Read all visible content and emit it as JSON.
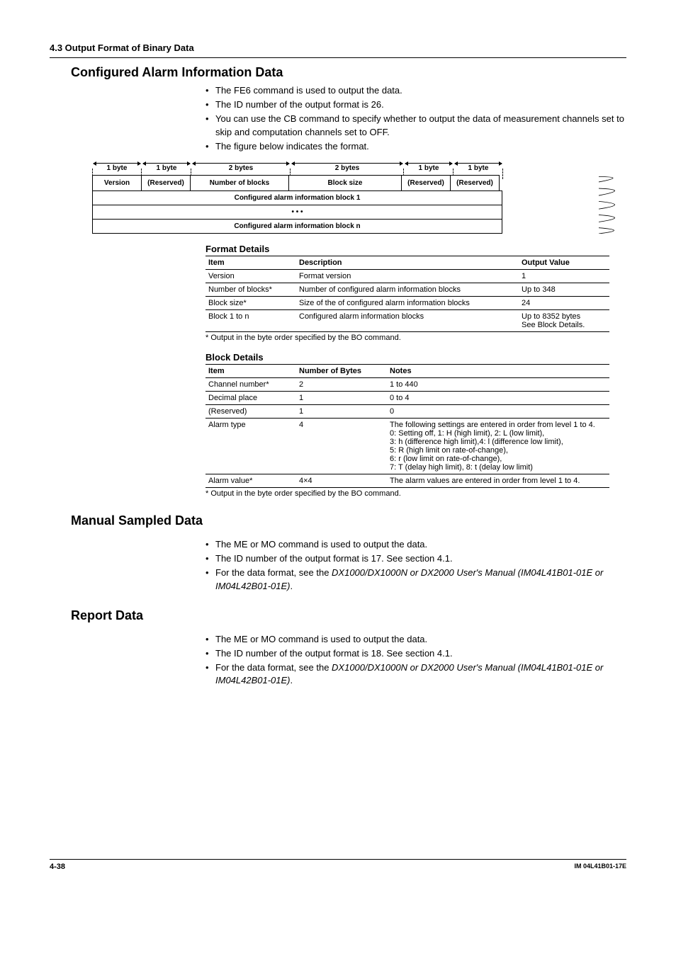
{
  "sectionHeader": "4.3  Output Format of Binary Data",
  "configured": {
    "title": "Configured Alarm Information Data",
    "bullets": [
      "The FE6 command is used to output the data.",
      "The ID number of the output format is 26.",
      "You can use the CB command to specify whether to output the data of measurement channels set to skip and computation channels set to OFF.",
      "The figure below indicates the format."
    ],
    "diagram": {
      "sizes": [
        "1 byte",
        "1 byte",
        "2 bytes",
        "2 bytes",
        "1 byte",
        "1 byte"
      ],
      "cells": [
        "Version",
        "(Reserved)",
        "Number of blocks",
        "Block size",
        "(Reserved)",
        "(Reserved)"
      ],
      "blocks": [
        "Configured alarm information block 1",
        "• • •",
        "Configured alarm information block n"
      ]
    },
    "formatDetails": {
      "title": "Format Details",
      "head": [
        "Item",
        "Description",
        "Output Value"
      ],
      "rows": [
        [
          "Version",
          "Format version",
          "1"
        ],
        [
          "Number of blocks*",
          "Number of configured alarm information blocks",
          "Up to 348"
        ],
        [
          "Block size*",
          "Size of the of configured alarm information blocks",
          "24"
        ],
        [
          "Block 1 to n",
          "Configured alarm information blocks",
          "Up to 8352 bytes\nSee Block Details."
        ]
      ],
      "foot": "* Output in the byte order specified by the BO command."
    },
    "blockDetails": {
      "title": "Block Details",
      "head": [
        "Item",
        "Number of Bytes",
        "Notes"
      ],
      "rows": [
        [
          "Channel number*",
          "2",
          "1 to 440"
        ],
        [
          "Decimal place",
          "1",
          "0 to 4"
        ],
        [
          "(Reserved)",
          "1",
          "0"
        ],
        [
          "Alarm type",
          "4",
          "The following settings are entered in order from level 1 to 4.\n0: Setting off, 1: H (high limit), 2: L (low limit),\n3: h (difference high limit),4: l (difference low limit),\n5: R (high limit on rate-of-change),\n6: r (low limit on rate-of-change),\n7: T (delay high limit), 8: t (delay low limit)"
        ],
        [
          "Alarm value*",
          "4×4",
          "The alarm values are entered in order from level 1 to 4."
        ]
      ],
      "foot": "* Output in the byte order specified by the BO command."
    }
  },
  "manual": {
    "title": "Manual Sampled Data",
    "bullets": [
      {
        "plain": "The ME or MO command is used to output the data."
      },
      {
        "plain": "The ID number of the output format is 17.  See section 4.1."
      },
      {
        "pre": "For the data format, see the ",
        "italic": "DX1000/DX1000N or DX2000 User's Manual (IM04L41B01-01E or IM04L42B01-01E)",
        "post": "."
      }
    ]
  },
  "report": {
    "title": "Report Data",
    "bullets": [
      {
        "plain": "The ME or MO command is used to output the data."
      },
      {
        "plain": "The ID number of the output format is 18.  See section 4.1."
      },
      {
        "pre": "For the data format, see the ",
        "italic": "DX1000/DX1000N or DX2000 User's Manual (IM04L41B01-01E or IM04L42B01-01E)",
        "post": "."
      }
    ]
  },
  "footer": {
    "page": "4-38",
    "doc": "IM 04L41B01-17E"
  },
  "chart_data": {
    "type": "table",
    "description": "Binary data output format structure for Configured Alarm Information Data (format ID 26)",
    "header_layout": [
      {
        "field": "Version",
        "bytes": 1
      },
      {
        "field": "(Reserved)",
        "bytes": 1
      },
      {
        "field": "Number of blocks",
        "bytes": 2
      },
      {
        "field": "Block size",
        "bytes": 2
      },
      {
        "field": "(Reserved)",
        "bytes": 1
      },
      {
        "field": "(Reserved)",
        "bytes": 1
      }
    ],
    "blocks": "Repeated blocks 1..n of Configured alarm information"
  }
}
